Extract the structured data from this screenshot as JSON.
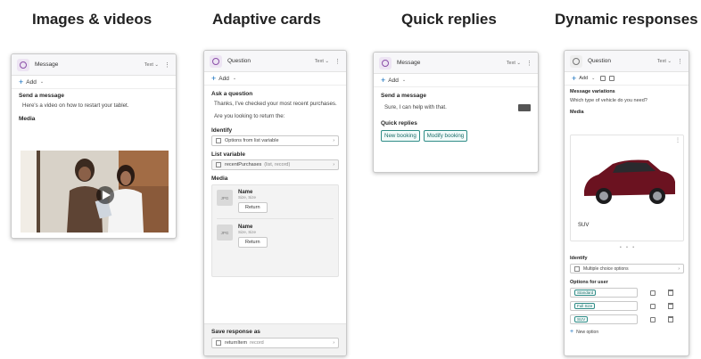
{
  "titles": [
    "Images & videos",
    "Adaptive cards",
    "Quick replies",
    "Dynamic responses"
  ],
  "c1": {
    "header": "Message",
    "right": "Text ⌄",
    "add": "Add",
    "section": "Send a message",
    "text": "Here's a video on how to restart your tablet.",
    "media_label": "Media"
  },
  "c2": {
    "header": "Question",
    "right": "Text ⌄",
    "add": "Add",
    "ask": "Ask a question",
    "q1": "Thanks, I've checked your most recent purchases.",
    "q2": "Are you looking to return the:",
    "identify": "Identify",
    "identify_val": "Options from list variable",
    "listvar": "List variable",
    "listvar_val": "recentPurchases",
    "listvar_type": "(list, record)",
    "media": "Media",
    "items": [
      {
        "thumb": "JPG",
        "name": "Name",
        "sub": "Size, Size",
        "btn": "Return"
      },
      {
        "thumb": "JPG",
        "name": "Name",
        "sub": "Size, Size",
        "btn": "Return"
      }
    ],
    "save": "Save response as",
    "save_val": "returnItem",
    "save_type": "record"
  },
  "c3": {
    "header": "Message",
    "right": "Text ⌄",
    "add": "Add",
    "section": "Send a message",
    "text": "Sure, I can help with that.",
    "qr_label": "Quick replies",
    "chips": [
      "New booking",
      "Modify booking"
    ]
  },
  "c4": {
    "header": "Question",
    "right": "Text ⌄",
    "add": "Add",
    "msgvar": "Message variations",
    "q": "Which type of vehicle do you need?",
    "media": "Media",
    "caption": "SUV",
    "identify": "Identify",
    "identify_val": "Multiple choice options",
    "options_label": "Options for user",
    "options": [
      "Standard",
      "Full Size",
      "SUV"
    ],
    "new_option": "New option"
  }
}
